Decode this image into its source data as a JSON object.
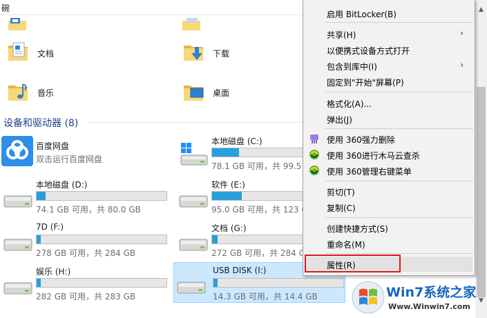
{
  "address_bar": {
    "text": "碗"
  },
  "folders": [
    {
      "label": "文档",
      "icon": "documents-folder-icon"
    },
    {
      "label": "下载",
      "icon": "downloads-folder-icon"
    },
    {
      "label": "音乐",
      "icon": "music-folder-icon"
    },
    {
      "label": "桌面",
      "icon": "desktop-folder-icon"
    }
  ],
  "section": {
    "title": "设备和驱动器 (8)"
  },
  "drives": [
    {
      "name": "百度网盘",
      "free": "双击运行百度网盘",
      "icon": "baidu-netdisk-icon",
      "used_fraction": null
    },
    {
      "name": "本地磁盘 (C:)",
      "free": "78.1 GB 可用，共 99.5",
      "icon": "windows-drive-icon",
      "used_fraction": 0.21
    },
    {
      "name": "本地磁盘 (D:)",
      "free": "74.1 GB 可用，共 80.0 GB",
      "icon": "hard-drive-icon",
      "used_fraction": 0.07
    },
    {
      "name": "软件 (E:)",
      "free": "95.0 GB 可用，共 123 G",
      "icon": "hard-drive-icon",
      "used_fraction": 0.23
    },
    {
      "name": "7D (F:)",
      "free": "278 GB 可用，共 284 GB",
      "icon": "hard-drive-icon",
      "used_fraction": 0.02
    },
    {
      "name": "文档 (G:)",
      "free": "272 GB 可用，共 284 GB",
      "icon": "hard-drive-icon",
      "used_fraction": 0.04
    },
    {
      "name": "娱乐 (H:)",
      "free": "282 GB 可用，共 283 GB",
      "icon": "hard-drive-icon",
      "used_fraction": 0.005
    },
    {
      "name": "USB DISK (I:)",
      "free": "14.3 GB 可用，共 14.4 GB",
      "icon": "usb-drive-icon",
      "used_fraction": 0.01
    }
  ],
  "context_menu": {
    "items": [
      {
        "label": "启用 BitLocker(B)",
        "icon": null,
        "submenu": false
      },
      {
        "label": "共享(H)",
        "icon": null,
        "submenu": true
      },
      {
        "label": "以便携式设备方式打开",
        "icon": null,
        "submenu": false
      },
      {
        "label": "包含到库中(I)",
        "icon": null,
        "submenu": true
      },
      {
        "label": "固定到\"开始\"屏幕(P)",
        "icon": null,
        "submenu": false
      },
      {
        "label": "格式化(A)...",
        "icon": null,
        "submenu": false
      },
      {
        "label": "弹出(J)",
        "icon": null,
        "submenu": false
      },
      {
        "label": "使用 360强力删除",
        "icon": "360-shred-icon",
        "submenu": false
      },
      {
        "label": "使用 360进行木马云查杀",
        "icon": "360-scan-icon",
        "submenu": false
      },
      {
        "label": "使用 360管理右键菜单",
        "icon": "360-menu-icon",
        "submenu": false
      },
      {
        "label": "剪切(T)",
        "icon": null,
        "submenu": false
      },
      {
        "label": "复制(C)",
        "icon": null,
        "submenu": false
      },
      {
        "label": "创建快捷方式(S)",
        "icon": null,
        "submenu": false
      },
      {
        "label": "重命名(M)",
        "icon": null,
        "submenu": false
      },
      {
        "label": "属性(R)",
        "icon": null,
        "submenu": false
      }
    ],
    "arrow_glyph": "›",
    "highlighted_item": "属性(R)"
  },
  "watermark": {
    "brand": "Win7系统之家",
    "url": "Www.Winwin7.com"
  },
  "colors": {
    "accent_bar": "#26a0da",
    "selection": "#cce8ff",
    "highlight_border": "#e0161b",
    "section_header": "#1e3f8a"
  }
}
